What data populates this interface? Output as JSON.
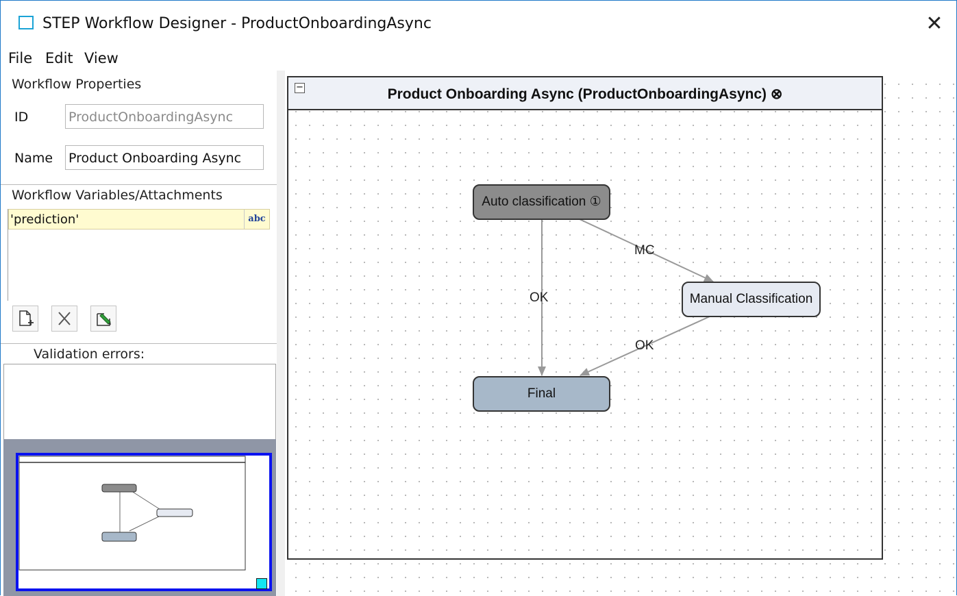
{
  "window": {
    "title": "STEP Workflow Designer - ProductOnboardingAsync",
    "close_glyph": "✕"
  },
  "menu": [
    "File",
    "Edit",
    "View"
  ],
  "properties": {
    "section_title": "Workflow Properties",
    "id_label": "ID",
    "id_value": "ProductOnboardingAsync",
    "name_label": "Name",
    "name_value": "Product Onboarding Async"
  },
  "variables": {
    "section_title": "Workflow Variables/Attachments",
    "items": [
      {
        "name": "'prediction'",
        "type": "abc"
      }
    ],
    "toolbar_icons": [
      "new-variable-icon",
      "delete-icon",
      "edit-icon"
    ]
  },
  "validation": {
    "title": "Validation errors:"
  },
  "workflow": {
    "title": "Product Onboarding Async (ProductOnboardingAsync) ⊗",
    "collapse_glyph": "−",
    "nodes": {
      "auto": "Auto classification ①",
      "manual": "Manual Classification",
      "final": "Final"
    },
    "edges": {
      "auto_to_final": "OK",
      "auto_to_manual": "MC",
      "manual_to_final": "OK"
    }
  },
  "colors": {
    "auto_node": "#8c8c8c",
    "manual_node": "#e6eaf2",
    "final_node": "#a7b8c9",
    "overview_border": "#0a12f0",
    "overview_bg": "#8f96a6",
    "variable_highlight": "#fffbd0"
  }
}
